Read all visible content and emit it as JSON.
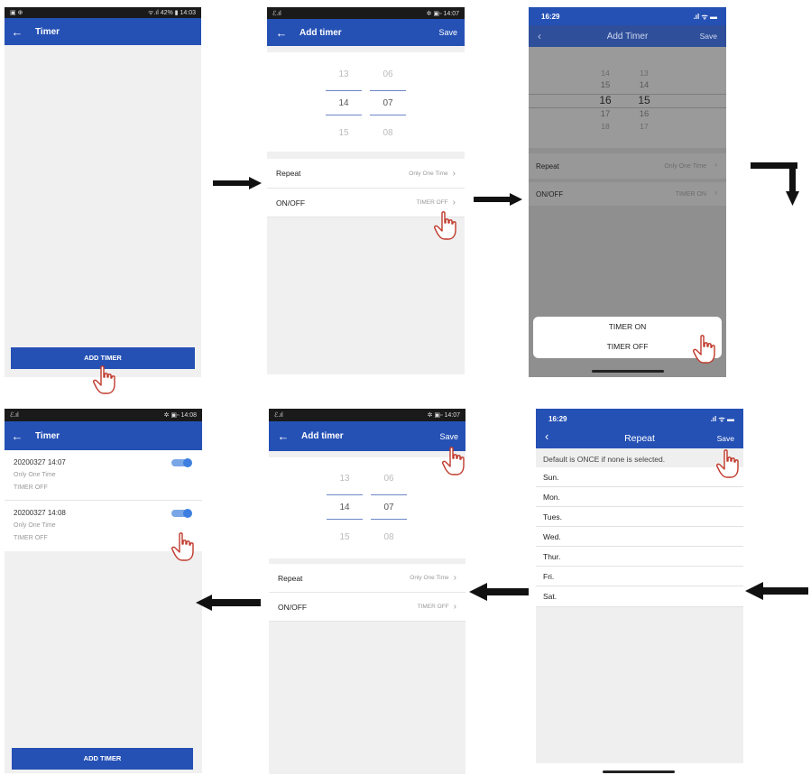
{
  "screens": {
    "s1": {
      "status": {
        "left": "▣ ⊕",
        "right": "ᯤ.ıl 42% ▮ 14:03"
      },
      "title": "Timer",
      "button": "ADD TIMER"
    },
    "s2": {
      "status": {
        "left": "ℰ.ıl",
        "right": "✲ ▣▫ 14:07"
      },
      "title": "Add timer",
      "save": "Save",
      "picker": {
        "hours": [
          "13",
          "14",
          "15"
        ],
        "minutes": [
          "06",
          "07",
          "08"
        ]
      },
      "rows": [
        {
          "label": "Repeat",
          "value": "Only One Time"
        },
        {
          "label": "ON/OFF",
          "value": "TIMER OFF"
        }
      ]
    },
    "s3": {
      "status": {
        "time": "16:29",
        "icons": ".ıl ᯤ ▬"
      },
      "title": "Add Timer",
      "save": "Save",
      "picker": {
        "hours": [
          "14",
          "15",
          "16",
          "17",
          "18"
        ],
        "minutes": [
          "13",
          "14",
          "15",
          "16",
          "17"
        ]
      },
      "rows": [
        {
          "label": "Repeat",
          "value": "Only One Time"
        },
        {
          "label": "ON/OFF",
          "value": "TIMER ON"
        }
      ],
      "sheet": [
        "TIMER ON",
        "TIMER OFF"
      ]
    },
    "s4": {
      "status": {
        "left": "ℰ.ıl",
        "right": "✲ ▣▫ 14:08"
      },
      "title": "Timer",
      "timers": [
        {
          "datetime": "20200327 14:07",
          "repeat": "Only One Time",
          "state": "TIMER OFF"
        },
        {
          "datetime": "20200327 14:08",
          "repeat": "Only One Time",
          "state": "TIMER OFF"
        }
      ],
      "button": "ADD TIMER"
    },
    "s5": {
      "status": {
        "left": "ℰ.ıl",
        "right": "✲ ▣▫ 14:07"
      },
      "title": "Add timer",
      "save": "Save",
      "picker": {
        "hours": [
          "13",
          "14",
          "15"
        ],
        "minutes": [
          "06",
          "07",
          "08"
        ]
      },
      "rows": [
        {
          "label": "Repeat",
          "value": "Only One Time"
        },
        {
          "label": "ON/OFF",
          "value": "TIMER OFF"
        }
      ]
    },
    "s6": {
      "status": {
        "time": "16:29",
        "icons": ".ıl ᯤ ▬"
      },
      "title": "Repeat",
      "save": "Save",
      "hint": "Default is ONCE if none is selected.",
      "days": [
        "Sun.",
        "Mon.",
        "Tues.",
        "Wed.",
        "Thur.",
        "Fri.",
        "Sat."
      ]
    }
  },
  "colors": {
    "appbar": "#2551b5",
    "arrow": "#111111",
    "hand": "#c0392b"
  }
}
